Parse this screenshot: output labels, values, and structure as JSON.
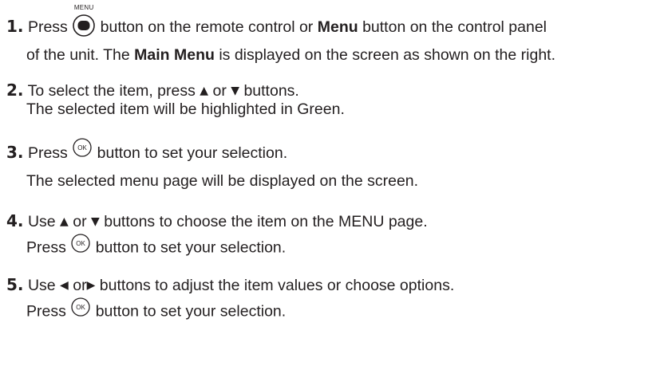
{
  "colors": {
    "text": "#231f20",
    "background": "#ffffff"
  },
  "icons": {
    "menu_button": "menu-round-button-icon",
    "ok_button": "ok-round-button-icon",
    "up": "triangle-up-icon",
    "down": "triangle-down-icon",
    "left": "triangle-left-icon",
    "right": "triangle-right-icon"
  },
  "steps": [
    {
      "number": "1.",
      "menu_caption": "MENU",
      "text_a": "Press",
      "text_b": "button on the remote control or",
      "bold_menu": "Menu",
      "text_c": "button on the control panel",
      "line2_a": "of the unit. The",
      "bold_main_menu": "Main Menu",
      "line2_b": "is displayed on the screen as shown on the right."
    },
    {
      "number": "2.",
      "line1_a": "To select the item, press",
      "up_arrow": "▲",
      "or": "or",
      "down_arrow": "▼",
      "line1_b": "buttons.",
      "line2": "The selected item will be highlighted in Green."
    },
    {
      "number": "3.",
      "line1_a": "Press",
      "ok_label": "OK",
      "line1_b": "button to set your selection.",
      "line2": "The selected menu page will be displayed on the screen."
    },
    {
      "number": "4.",
      "line1_a": "Use",
      "up_arrow": "▲",
      "or": "or",
      "down_arrow": "▼",
      "line1_b": "buttons to choose the item on the MENU page.",
      "line2_a": "Press",
      "ok_label": "OK",
      "line2_b": "button to set your selection."
    },
    {
      "number": "5.",
      "line1_a": "Use",
      "left_arrow": "◀",
      "or": "or",
      "right_arrow": "▶",
      "line1_b": "buttons to adjust the item values or choose options.",
      "line2_a": "Press",
      "ok_label": "OK",
      "line2_b": "button to set your selection."
    }
  ]
}
